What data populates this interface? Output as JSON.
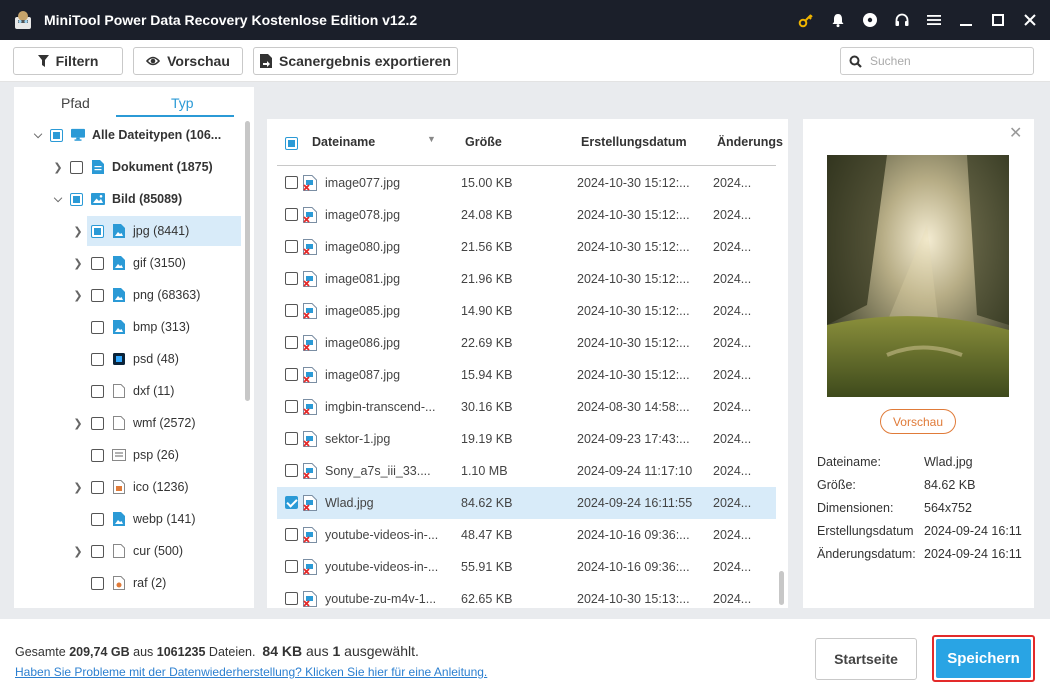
{
  "window": {
    "title": "MiniTool Power Data Recovery Kostenlose Edition v12.2"
  },
  "toolbar": {
    "filter_label": "Filtern",
    "preview_label": "Vorschau",
    "export_label": "Scanergebnis exportieren",
    "search_placeholder": "Suchen"
  },
  "tabs": {
    "path": "Pfad",
    "type": "Typ"
  },
  "tree": {
    "root": "Alle Dateitypen (106...",
    "items": [
      {
        "label": "Dokument (1875)"
      },
      {
        "label": "Bild (85089)"
      },
      {
        "label": "jpg (8441)"
      },
      {
        "label": "gif (3150)"
      },
      {
        "label": "png (68363)"
      },
      {
        "label": "bmp (313)"
      },
      {
        "label": "psd (48)"
      },
      {
        "label": "dxf (11)"
      },
      {
        "label": "wmf (2572)"
      },
      {
        "label": "psp (26)"
      },
      {
        "label": "ico (1236)"
      },
      {
        "label": "webp (141)"
      },
      {
        "label": "cur (500)"
      },
      {
        "label": "raf (2)"
      }
    ]
  },
  "list": {
    "columns": {
      "name": "Dateiname",
      "size": "Größe",
      "created": "Erstellungsdatum",
      "modified": "Änderungs"
    },
    "rows": [
      {
        "name": "image077.jpg",
        "size": "15.00 KB",
        "created": "2024-10-30 15:12:...",
        "modified": "2024..."
      },
      {
        "name": "image078.jpg",
        "size": "24.08 KB",
        "created": "2024-10-30 15:12:...",
        "modified": "2024..."
      },
      {
        "name": "image080.jpg",
        "size": "21.56 KB",
        "created": "2024-10-30 15:12:...",
        "modified": "2024..."
      },
      {
        "name": "image081.jpg",
        "size": "21.96 KB",
        "created": "2024-10-30 15:12:...",
        "modified": "2024..."
      },
      {
        "name": "image085.jpg",
        "size": "14.90 KB",
        "created": "2024-10-30 15:12:...",
        "modified": "2024..."
      },
      {
        "name": "image086.jpg",
        "size": "22.69 KB",
        "created": "2024-10-30 15:12:...",
        "modified": "2024..."
      },
      {
        "name": "image087.jpg",
        "size": "15.94 KB",
        "created": "2024-10-30 15:12:...",
        "modified": "2024..."
      },
      {
        "name": "imgbin-transcend-...",
        "size": "30.16 KB",
        "created": "2024-08-30 14:58:...",
        "modified": "2024..."
      },
      {
        "name": "sektor-1.jpg",
        "size": "19.19 KB",
        "created": "2024-09-23 17:43:...",
        "modified": "2024..."
      },
      {
        "name": "Sony_a7s_iii_33....",
        "size": "1.10 MB",
        "created": "2024-09-24 11:17:10",
        "modified": "2024..."
      },
      {
        "name": "Wlad.jpg",
        "size": "84.62 KB",
        "created": "2024-09-24 16:11:55",
        "modified": "2024..."
      },
      {
        "name": "youtube-videos-in-...",
        "size": "48.47 KB",
        "created": "2024-10-16 09:36:...",
        "modified": "2024..."
      },
      {
        "name": "youtube-videos-in-...",
        "size": "55.91 KB",
        "created": "2024-10-16 09:36:...",
        "modified": "2024..."
      },
      {
        "name": "youtube-zu-m4v-1...",
        "size": "62.65 KB",
        "created": "2024-10-30 15:13:...",
        "modified": "2024..."
      }
    ]
  },
  "preview": {
    "button_label": "Vorschau",
    "props": [
      {
        "key": "Dateiname:",
        "value": "Wlad.jpg"
      },
      {
        "key": "Größe:",
        "value": "84.62 KB"
      },
      {
        "key": "Dimensionen:",
        "value": "564x752"
      },
      {
        "key": "Erstellungsdatum",
        "value": "2024-09-24 16:11"
      },
      {
        "key": "Änderungsdatum:",
        "value": "2024-09-24 16:11"
      }
    ]
  },
  "footer": {
    "total_prefix": "Gesamte ",
    "total_size": "209,74 GB",
    "total_mid": " aus ",
    "total_count": "1061235",
    "total_suffix": " Dateien.",
    "sel_size": "84 KB",
    "sel_mid": " aus ",
    "sel_count": "1",
    "sel_suffix": " ausgewählt.",
    "help_link": "Haben Sie Probleme mit der Datenwiederherstellung? Klicken Sie hier für eine Anleitung.",
    "home_label": "Startseite",
    "save_label": "Speichern"
  },
  "colors": {
    "accent": "#29a4e4",
    "titlebar": "#1b1f2a",
    "key_icon": "#f0b400",
    "save_border": "#e32a2a",
    "preview_btn": "#e07b39"
  }
}
